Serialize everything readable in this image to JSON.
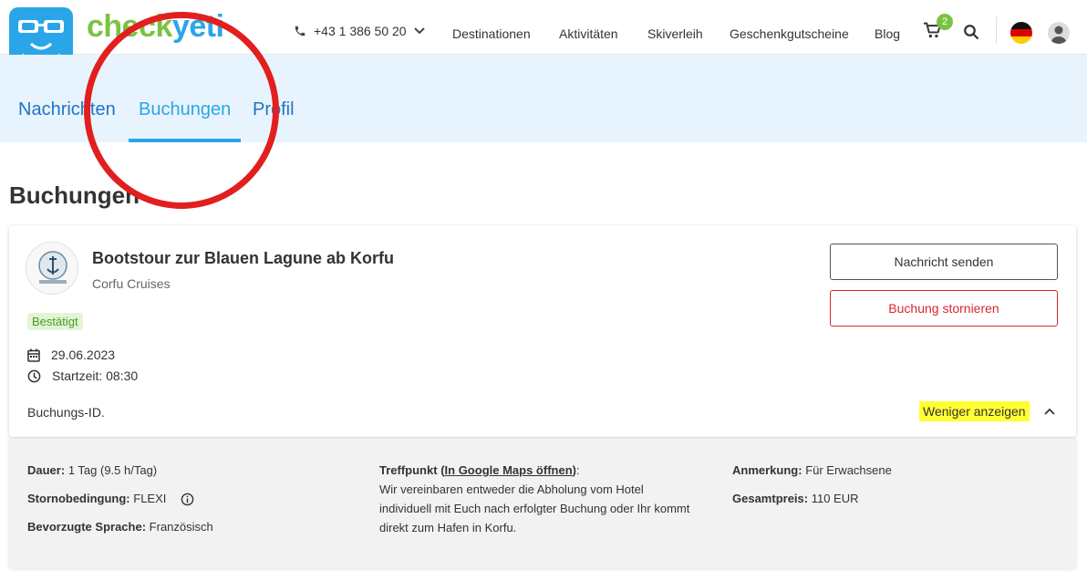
{
  "header": {
    "logo_part1": "check",
    "logo_part2": "yeti",
    "phone": "+43 1 386 50 20",
    "nav": [
      "Destinationen",
      "Aktivitäten",
      "Skiverleih",
      "Geschenkgutscheine",
      "Blog"
    ],
    "cart_count": "2",
    "flag": "DE"
  },
  "tabs": [
    "Nachrichten",
    "Buchungen",
    "Profil"
  ],
  "active_tab": "Buchungen",
  "page_title": "Buchungen",
  "booking": {
    "title": "Bootstour zur Blauen Lagune ab Korfu",
    "provider": "Corfu Cruises",
    "status": "Bestätigt",
    "date": "29.06.2023",
    "start_time": "Startzeit: 08:30",
    "booking_id_label": "Buchungs-ID.",
    "send_message": "Nachricht senden",
    "cancel": "Buchung stornieren",
    "show_less": "Weniger anzeigen"
  },
  "details": {
    "duration_label": "Dauer:",
    "duration_value": "1 Tag (9.5 h/Tag)",
    "cancellation_label": "Stornobedingung:",
    "cancellation_value": "FLEXI",
    "language_label": "Bevorzugte Sprache:",
    "language_value": "Französisch",
    "meeting_label": "Treffpunkt",
    "meeting_link": "In Google Maps öffnen",
    "meeting_text": "Wir vereinbaren entweder die Abholung vom Hotel individuell mit Euch nach erfolgter Buchung oder Ihr kommt direkt zum Hafen in Korfu.",
    "note_label": "Anmerkung:",
    "note_value": "Für Erwachsene",
    "price_label": "Gesamtpreis:",
    "price_value": "110 EUR"
  },
  "colors": {
    "brand_blue": "#2aa6e8",
    "brand_green": "#7cc242",
    "cancel_red": "#d9272e",
    "annotation_red": "#e21f1f",
    "highlight_yellow": "#ffff33"
  }
}
